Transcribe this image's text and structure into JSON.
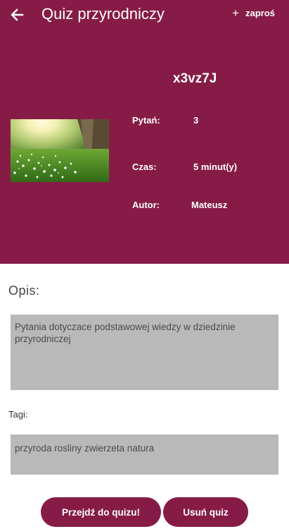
{
  "appbar": {
    "title": "Quiz przyrodniczy",
    "invite_label": "zaproś",
    "invite_icon": "+"
  },
  "quiz": {
    "code": "x3vz7J",
    "questions_label": "Pytań:",
    "questions_value": "3",
    "time_label": "Czas:",
    "time_value": "5 minut(y)",
    "author_label": "Autor:",
    "author_value": "Mateusz"
  },
  "description": {
    "title": "Opis:",
    "text": "Pytania dotyczace podstawowej wiedzy w dziedzinie przyrodniczej"
  },
  "tags": {
    "title": "Tagi:",
    "text": "przyroda rosliny zwierzeta natura"
  },
  "actions": {
    "start_label": "Przejdź do quizu!",
    "delete_label": "Usuń quiz"
  },
  "colors": {
    "brand": "#861c46",
    "field_bg": "#b9b9b9"
  }
}
